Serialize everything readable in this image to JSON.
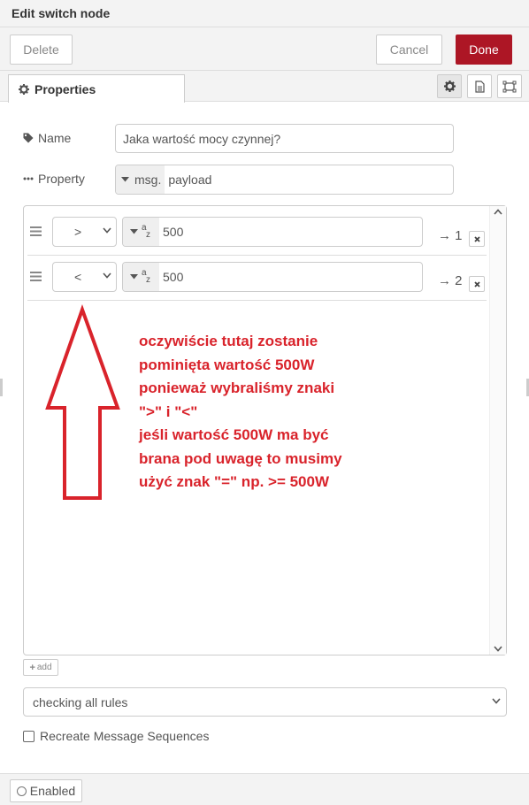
{
  "header": {
    "title": "Edit switch node"
  },
  "toolbar": {
    "delete_label": "Delete",
    "cancel_label": "Cancel",
    "done_label": "Done"
  },
  "tabs": {
    "properties_label": "Properties"
  },
  "form": {
    "name_label": "Name",
    "name_value": "Jaka wartość mocy czynnej?",
    "property_label": "Property",
    "property_type": "msg.",
    "property_value": "payload"
  },
  "rules": [
    {
      "operator": ">",
      "value_type": "a z",
      "value": "500",
      "output": "→ 1"
    },
    {
      "operator": "<",
      "value_type": "a z",
      "value": "500",
      "output": "→ 2"
    }
  ],
  "annotation": {
    "text": "oczywiście tutaj zostanie\npominięta wartość 500W\nponieważ wybraliśmy znaki\n\">\" i \"<\"\njeśli wartość 500W ma być\nbrana pod uwagę to musimy\nużyć znak \"=\" np. >= 500W",
    "color": "#d9232b"
  },
  "add_label": "add",
  "mode": {
    "selected": "checking all rules"
  },
  "recreate": {
    "label": "Recreate Message Sequences",
    "checked": false
  },
  "footer": {
    "enabled_label": "Enabled"
  },
  "colors": {
    "primary": "#ad1625",
    "border": "#cccccc",
    "panel_bg": "#f3f3f3"
  },
  "icons": [
    "gear-icon",
    "description-icon",
    "appearance-icon",
    "tag-icon",
    "ellipsis-icon",
    "caret-down-icon",
    "drag-handle-icon",
    "chevron-down-icon",
    "string-type-icon",
    "remove-icon",
    "scroll-up-icon",
    "scroll-down-icon",
    "plus-icon",
    "circle-icon"
  ]
}
